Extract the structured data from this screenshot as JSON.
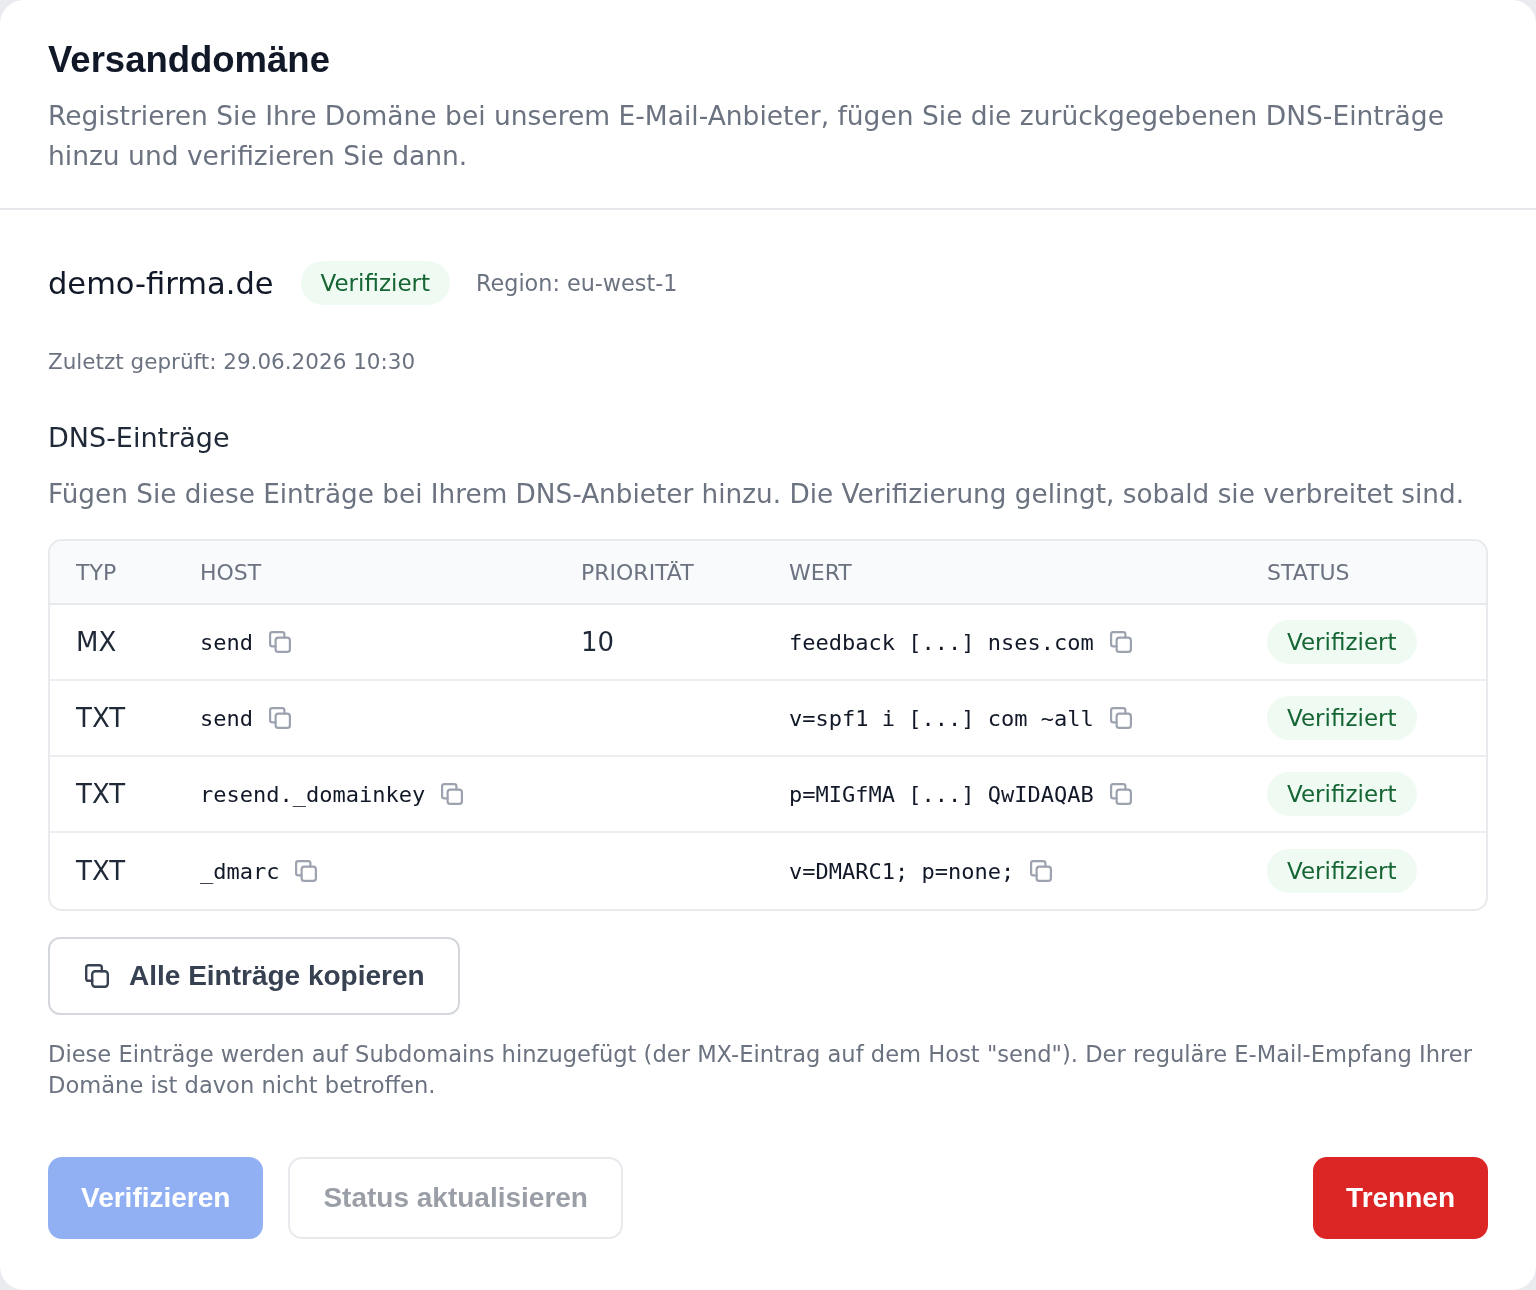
{
  "header": {
    "title": "Versanddomäne",
    "description": "Registrieren Sie Ihre Domäne bei unserem E-Mail-Anbieter, fügen Sie die zurückgegebenen DNS-Einträge hinzu und verifizieren Sie dann."
  },
  "domain": {
    "name": "demo-firma.de",
    "status": "Verifiziert",
    "region": "Region: eu-west-1",
    "last_checked": "Zuletzt geprüft: 29.06.2026 10:30"
  },
  "dns_section": {
    "title": "DNS-Einträge",
    "description": "Fügen Sie diese Einträge bei Ihrem DNS-Anbieter hinzu. Die Verifizierung gelingt, sobald sie verbreitet sind."
  },
  "table": {
    "columns": [
      "TYP",
      "HOST",
      "PRIORITÄT",
      "WERT",
      "STATUS"
    ],
    "rows": [
      {
        "type": "MX",
        "host": "send",
        "priority": "10",
        "value": "feedback [...] nses.com",
        "status": "Verifiziert"
      },
      {
        "type": "TXT",
        "host": "send",
        "value": "v=spf1 i [...] com ~all",
        "status": "Verifiziert"
      },
      {
        "type": "TXT",
        "host": "resend._domainkey",
        "value": "p=MIGfMA [...] QwIDAQAB",
        "status": "Verifiziert"
      },
      {
        "type": "TXT",
        "host": "_dmarc",
        "value": "v=DMARC1; p=none;",
        "status": "Verifiziert"
      }
    ]
  },
  "copy_all_button": {
    "label": "Alle Einträge kopieren"
  },
  "note": "Diese Einträge werden auf Subdomains hinzugefügt (der MX-Eintrag auf dem Host \"send\"). Der reguläre E-Mail-Empfang Ihrer Domäne ist davon nicht betroffen.",
  "actions": [
    {
      "label": "Verifizieren",
      "kind": "primary",
      "disabled": true
    },
    {
      "label": "Status aktualisieren",
      "kind": "secondary",
      "disabled": true
    },
    {
      "label": "Trennen",
      "kind": "danger",
      "disabled": false
    }
  ]
}
